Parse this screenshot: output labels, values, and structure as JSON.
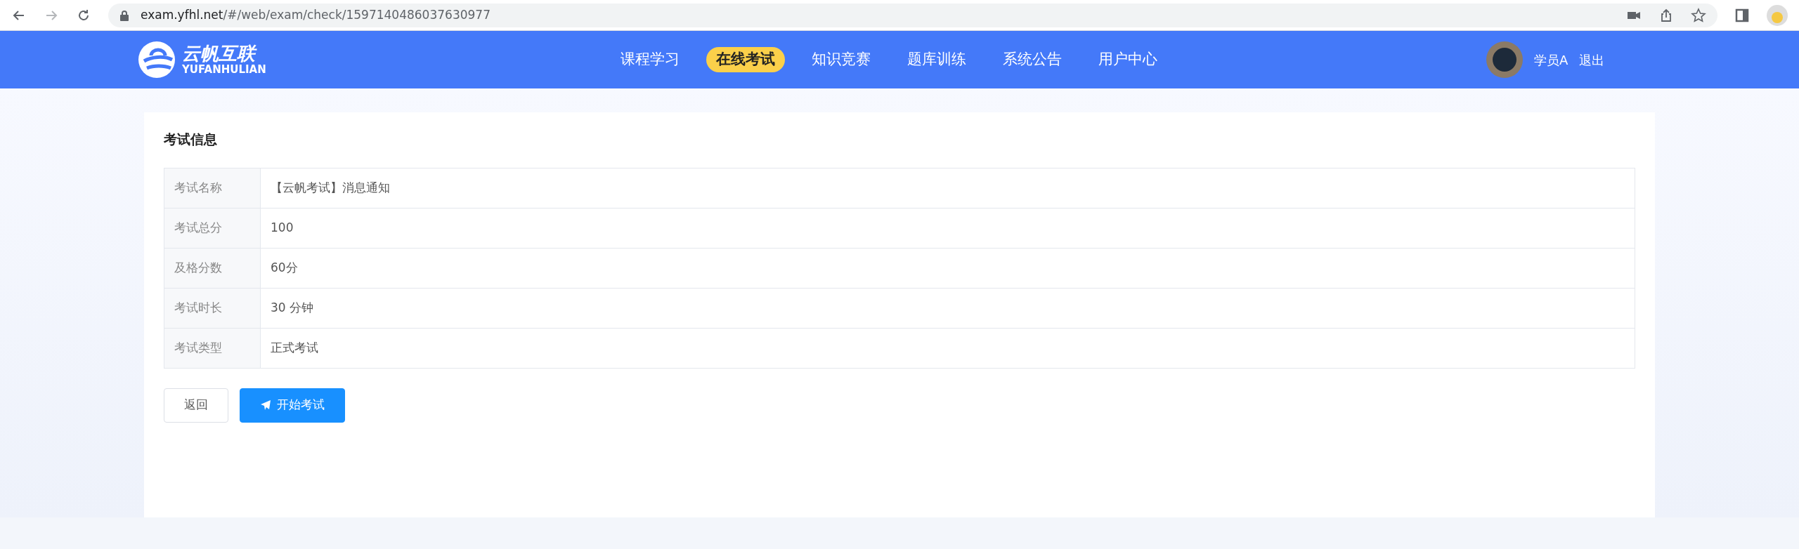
{
  "browser": {
    "url_host": "exam.yfhl.net",
    "url_path": "/#/web/exam/check/1597140486037630977"
  },
  "header": {
    "logo_title": "云帆互联",
    "logo_subtitle": "YUFANHULIAN",
    "nav": [
      {
        "label": "课程学习",
        "selected": false
      },
      {
        "label": "在线考试",
        "selected": true
      },
      {
        "label": "知识竞赛",
        "selected": false
      },
      {
        "label": "题库训练",
        "selected": false
      },
      {
        "label": "系统公告",
        "selected": false
      },
      {
        "label": "用户中心",
        "selected": false
      }
    ],
    "user_name": "学员A",
    "logout": "退出"
  },
  "card": {
    "title": "考试信息",
    "rows": [
      {
        "label": "考试名称",
        "value": "【云帆考试】消息通知"
      },
      {
        "label": "考试总分",
        "value": "100"
      },
      {
        "label": "及格分数",
        "value": "60分"
      },
      {
        "label": "考试时长",
        "value": "30 分钟"
      },
      {
        "label": "考试类型",
        "value": "正式考试"
      }
    ],
    "buttons": [
      {
        "label": "返回",
        "kind": "default"
      },
      {
        "label": "开始考试",
        "kind": "primary"
      }
    ]
  }
}
